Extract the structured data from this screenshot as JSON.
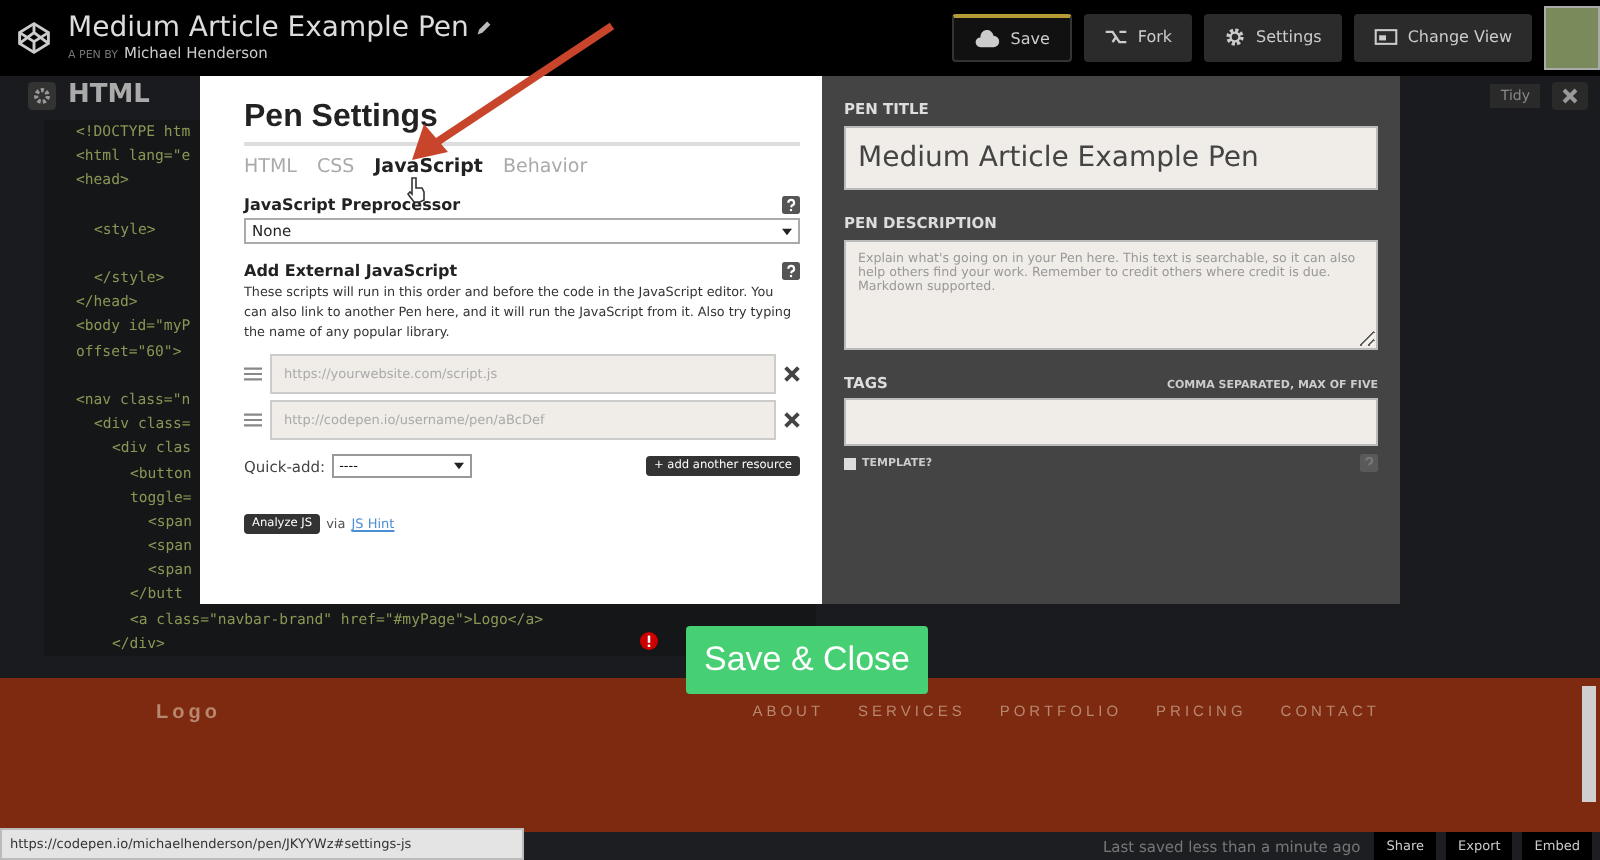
{
  "header": {
    "title": "Medium Article Example Pen",
    "byline_prefix": "A PEN BY",
    "author": "Michael Henderson",
    "buttons": [
      {
        "label": "Save",
        "kind": "save"
      },
      {
        "label": "Fork",
        "kind": "fork"
      },
      {
        "label": "Settings",
        "kind": "settings"
      },
      {
        "label": "Change View",
        "kind": "view"
      }
    ]
  },
  "editor": {
    "title": "HTML",
    "tidy": "Tidy",
    "code_lines": [
      {
        "kind": "code",
        "text": "<!DOCTYPE htm"
      },
      {
        "kind": "code",
        "text": "<html lang=\"e"
      },
      {
        "kind": "code",
        "text": "<head>",
        "children": [
          {
            "kind": "blank"
          },
          {
            "kind": "code",
            "text": "<style>"
          },
          {
            "kind": "blank"
          },
          {
            "kind": "code",
            "text": "</style>"
          }
        ]
      },
      {
        "kind": "code",
        "text": "</head>"
      },
      {
        "kind": "code",
        "text": "<body id=\"myP"
      },
      {
        "kind": "code",
        "text": "offset=\"60\">"
      },
      {
        "kind": "blank"
      },
      {
        "kind": "code",
        "text": "<nav class=\"n",
        "children": [
          {
            "kind": "code",
            "text": "<div class=",
            "children": [
              {
                "kind": "code",
                "text": "<div clas",
                "children": [
                  {
                    "kind": "code",
                    "text": "<button"
                  },
                  {
                    "kind": "code",
                    "text": "toggle=",
                    "children": [
                      {
                        "kind": "code",
                        "text": "<span"
                      },
                      {
                        "kind": "code",
                        "text": "<span"
                      },
                      {
                        "kind": "code",
                        "text": "<span"
                      }
                    ]
                  },
                  {
                    "kind": "code",
                    "text": "</butt"
                  },
                  {
                    "kind": "code",
                    "text": "<a class=\"navbar-brand\" href=\"#myPage\">Logo</a>"
                  }
                ]
              },
              {
                "kind": "code",
                "text": "</div>"
              }
            ]
          }
        ]
      }
    ]
  },
  "settings": {
    "title": "Pen Settings",
    "tabs": [
      {
        "label": "HTML",
        "selected": false
      },
      {
        "label": "CSS",
        "selected": false
      },
      {
        "label": "JavaScript",
        "selected": true
      },
      {
        "label": "Behavior",
        "selected": false
      }
    ],
    "preprocessor": {
      "label": "JavaScript Preprocessor",
      "value": "None"
    },
    "external": {
      "label": "Add External JavaScript",
      "description": "These scripts will run in this order and before the code in the JavaScript editor. You can also link to another Pen here, and it will run the JavaScript from it. Also try typing the name of any popular library.",
      "resources": [
        {
          "placeholder": "https://yourwebsite.com/script.js"
        },
        {
          "placeholder": "http://codepen.io/username/pen/aBcDef"
        }
      ],
      "quick_add_label": "Quick-add:",
      "quick_add_value": "----",
      "add_button": "+ add another resource"
    },
    "analyze": {
      "button": "Analyze JS",
      "via": "via",
      "link": "JS Hint"
    },
    "pen_title": {
      "label": "PEN TITLE",
      "value": "Medium Article Example Pen"
    },
    "pen_description": {
      "label": "PEN DESCRIPTION",
      "placeholder": "Explain what's going on in your Pen here. This text is searchable, so it can also help others find your work. Remember to credit others where credit is due. Markdown supported."
    },
    "tags": {
      "label": "TAGS",
      "hint": "COMMA SEPARATED, MAX OF FIVE"
    },
    "template": {
      "label": "TEMPLATE?",
      "checked": false
    },
    "save_close": "Save & Close"
  },
  "preview": {
    "logo": "Logo",
    "nav": [
      "ABOUT",
      "SERVICES",
      "PORTFOLIO",
      "PRICING",
      "CONTACT"
    ]
  },
  "footer": {
    "status": "Last saved less than a minute ago",
    "buttons": [
      "Share",
      "Export",
      "Embed"
    ],
    "link_tooltip": "https://codepen.io/michaelhenderson/pen/JKYYWz#settings-js"
  }
}
